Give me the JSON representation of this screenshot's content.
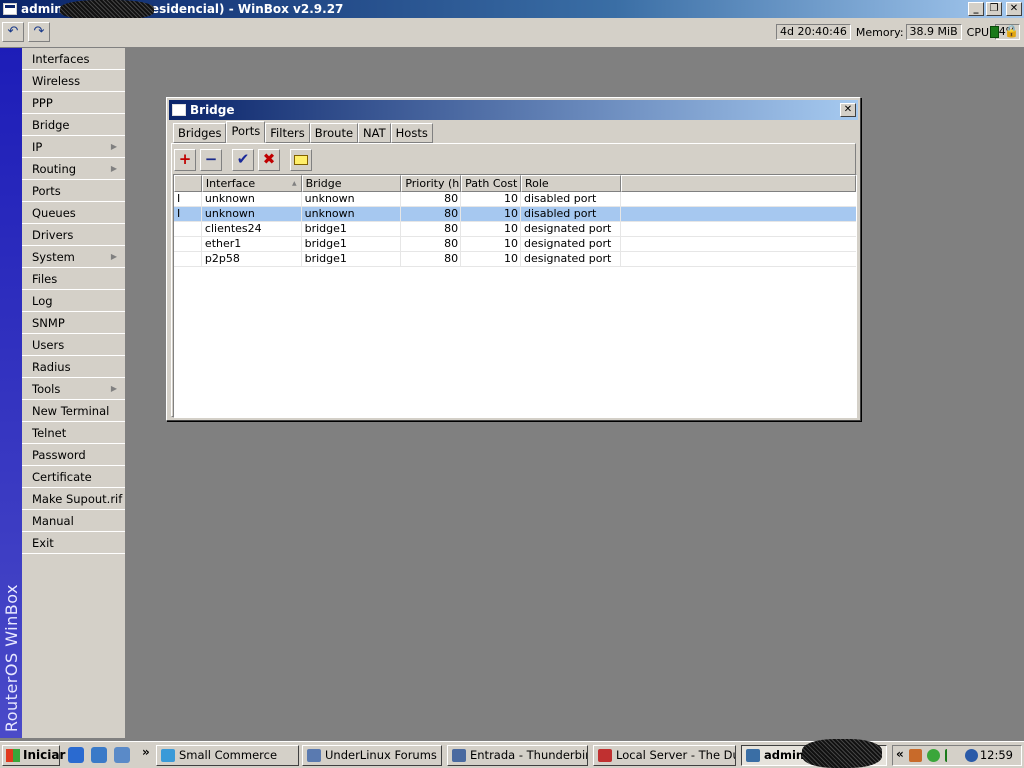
{
  "app": {
    "title": "admin@                Residencial) - WinBox v2.9.27"
  },
  "toolbar": {
    "undo_icon": "undo-icon",
    "redo_icon": "redo-icon",
    "uptime": "4d 20:40:46",
    "memory_label": "Memory:",
    "memory_value": "38.9 MiB",
    "cpu_label": "CPU:",
    "cpu_value": "4%"
  },
  "brand": "RouterOS WinBox",
  "sidebar": {
    "items": [
      {
        "label": "Interfaces",
        "submenu": false
      },
      {
        "label": "Wireless",
        "submenu": false
      },
      {
        "label": "PPP",
        "submenu": false
      },
      {
        "label": "Bridge",
        "submenu": false
      },
      {
        "label": "IP",
        "submenu": true
      },
      {
        "label": "Routing",
        "submenu": true
      },
      {
        "label": "Ports",
        "submenu": false
      },
      {
        "label": "Queues",
        "submenu": false
      },
      {
        "label": "Drivers",
        "submenu": false
      },
      {
        "label": "System",
        "submenu": true
      },
      {
        "label": "Files",
        "submenu": false
      },
      {
        "label": "Log",
        "submenu": false
      },
      {
        "label": "SNMP",
        "submenu": false
      },
      {
        "label": "Users",
        "submenu": false
      },
      {
        "label": "Radius",
        "submenu": false
      },
      {
        "label": "Tools",
        "submenu": true
      },
      {
        "label": "New Terminal",
        "submenu": false
      },
      {
        "label": "Telnet",
        "submenu": false
      },
      {
        "label": "Password",
        "submenu": false
      },
      {
        "label": "Certificate",
        "submenu": false
      },
      {
        "label": "Make Supout.rif",
        "submenu": false
      },
      {
        "label": "Manual",
        "submenu": false
      },
      {
        "label": "Exit",
        "submenu": false
      }
    ]
  },
  "bridge_window": {
    "title": "Bridge",
    "tabs": [
      {
        "label": "Bridges",
        "active": false
      },
      {
        "label": "Ports",
        "active": true
      },
      {
        "label": "Filters",
        "active": false
      },
      {
        "label": "Broute",
        "active": false
      },
      {
        "label": "NAT",
        "active": false
      },
      {
        "label": "Hosts",
        "active": false
      }
    ],
    "tools": {
      "add": "+",
      "remove": "−",
      "enable": "✔",
      "disable": "✖",
      "comment_icon": "comment-icon"
    },
    "columns": [
      "",
      "Interface",
      "Bridge",
      "Priority (h...",
      "Path Cost",
      "Role",
      ""
    ],
    "sort_indicator": "▲",
    "rows": [
      {
        "flag": "I",
        "interface": "unknown",
        "bridge": "unknown",
        "priority": "80",
        "path_cost": "10",
        "role": "disabled port",
        "selected": false
      },
      {
        "flag": "I",
        "interface": "unknown",
        "bridge": "unknown",
        "priority": "80",
        "path_cost": "10",
        "role": "disabled port",
        "selected": true
      },
      {
        "flag": "",
        "interface": "clientes24",
        "bridge": "bridge1",
        "priority": "80",
        "path_cost": "10",
        "role": "designated port",
        "selected": false
      },
      {
        "flag": "",
        "interface": "ether1",
        "bridge": "bridge1",
        "priority": "80",
        "path_cost": "10",
        "role": "designated port",
        "selected": false
      },
      {
        "flag": "",
        "interface": "p2p58",
        "bridge": "bridge1",
        "priority": "80",
        "path_cost": "10",
        "role": "designated port",
        "selected": false
      }
    ]
  },
  "taskbar": {
    "start_label": "Iniciar",
    "chevron": "»",
    "tasks": [
      {
        "label": "Small Commerce",
        "color": "#3a9ad8",
        "active": false
      },
      {
        "label": "UnderLinux Forums - ...",
        "color": "#5a7ab0",
        "active": false
      },
      {
        "label": "Entrada - Thunderbird",
        "color": "#4a6aa0",
        "active": false
      },
      {
        "label": "Local Server - The Du...",
        "color": "#c03030",
        "active": false
      },
      {
        "label": "admin",
        "color": "#3a6ea5",
        "active": true
      }
    ],
    "tray_chevron": "«",
    "clock": "12:59"
  }
}
